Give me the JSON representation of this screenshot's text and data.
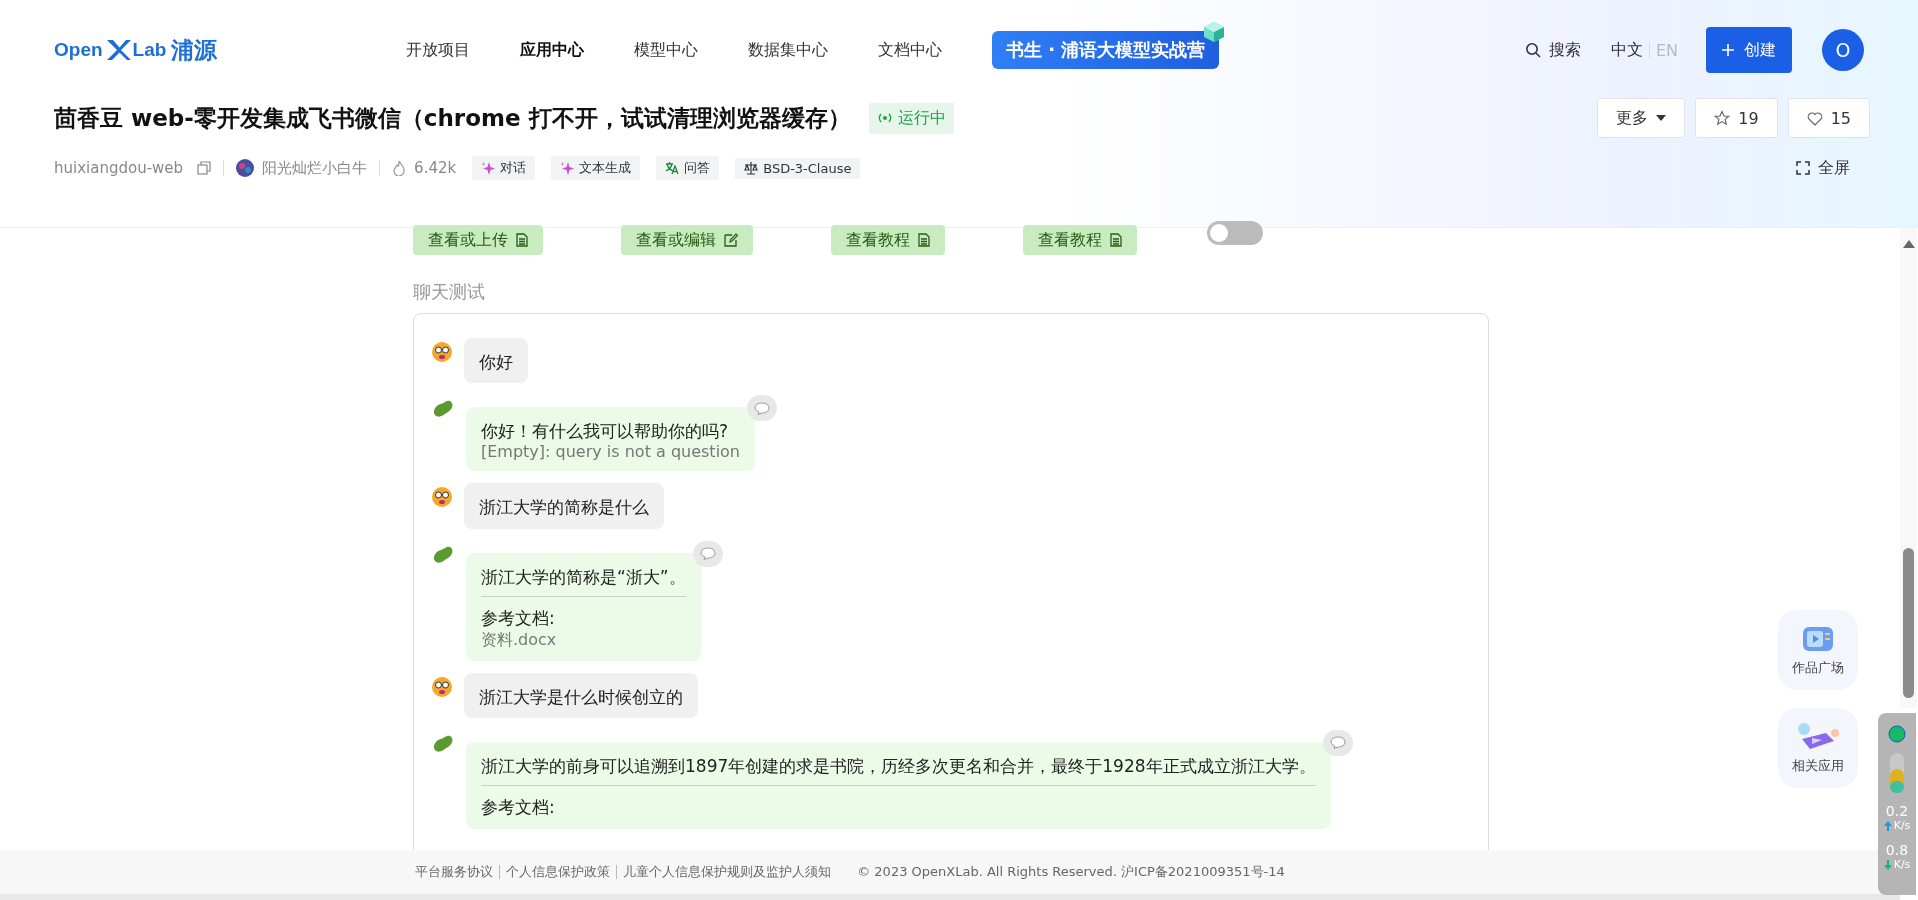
{
  "topbar": {
    "logo": {
      "left": "Open",
      "right": "Lab",
      "cn": "浦源"
    },
    "nav_items": [
      {
        "label": "开放项目",
        "selected": false
      },
      {
        "label": "应用中心",
        "selected": true
      },
      {
        "label": "模型中心",
        "selected": false
      },
      {
        "label": "数据集中心",
        "selected": false
      },
      {
        "label": "文档中心",
        "selected": false
      }
    ],
    "banner": "书生 · 浦语大模型实战营",
    "search": "搜索",
    "languages": [
      {
        "label": "中文",
        "selected": true
      },
      {
        "label": "EN",
        "selected": false
      }
    ],
    "create_button": "创建",
    "avatar": "O"
  },
  "app": {
    "title": "茴香豆 web-零开发集成飞书微信（chrome 打不开，试试清理浏览器缓存）",
    "status": "运行中",
    "more": "更多",
    "stars": "19",
    "likes": "15",
    "repo": "huixiangdou-web",
    "author": "阳光灿烂小白牛",
    "views": "6.42k",
    "tags": [
      {
        "label": "对话",
        "kind": "sparkle"
      },
      {
        "label": "文本生成",
        "kind": "sparkle"
      },
      {
        "label": "问答",
        "kind": "translate"
      },
      {
        "label": "BSD-3-Clause",
        "kind": "scale"
      }
    ],
    "fullscreen": "全屏"
  },
  "actions": [
    {
      "label": "查看或上传",
      "kind": "doc"
    },
    {
      "label": "查看或编辑",
      "kind": "edit"
    },
    {
      "label": "查看教程",
      "kind": "doc"
    },
    {
      "label": "查看教程",
      "kind": "doc"
    }
  ],
  "toggle": {
    "on": false
  },
  "chat": {
    "title": "聊天测试",
    "messages": [
      {
        "kind": "user",
        "text": "你好"
      },
      {
        "kind": "bot",
        "text": "你好！有什么我可以帮助你的吗?",
        "note": "[Empty]: query is not a question"
      },
      {
        "kind": "user",
        "text": "浙江大学的简称是什么"
      },
      {
        "kind": "bot",
        "text": "浙江大学的简称是“浙大”。",
        "ref_label": "参考文档:",
        "ref_file": "资料.docx"
      },
      {
        "kind": "user",
        "text": "浙江大学是什么时候创立的"
      },
      {
        "kind": "bot",
        "text": "浙江大学的前身可以追溯到1897年创建的求是书院，历经多次更名和合并，最终于1928年正式成立浙江大学。",
        "ref_label": "参考文档:"
      }
    ]
  },
  "side_buttons": [
    {
      "label": "作品广场",
      "kind": "tv"
    },
    {
      "label": "相关应用",
      "kind": "play"
    }
  ],
  "net_monitor": {
    "upload": "0.2",
    "upload_unit": "K/s",
    "download": "0.8",
    "download_unit": "K/s"
  },
  "footer": {
    "links": [
      "平台服务协议",
      "个人信息保护政策",
      "儿童个人信息保护规则及监护人须知"
    ],
    "copyright": "© 2023 OpenXLab. All Rights Reserved. 沪ICP备2021009351号-14"
  }
}
